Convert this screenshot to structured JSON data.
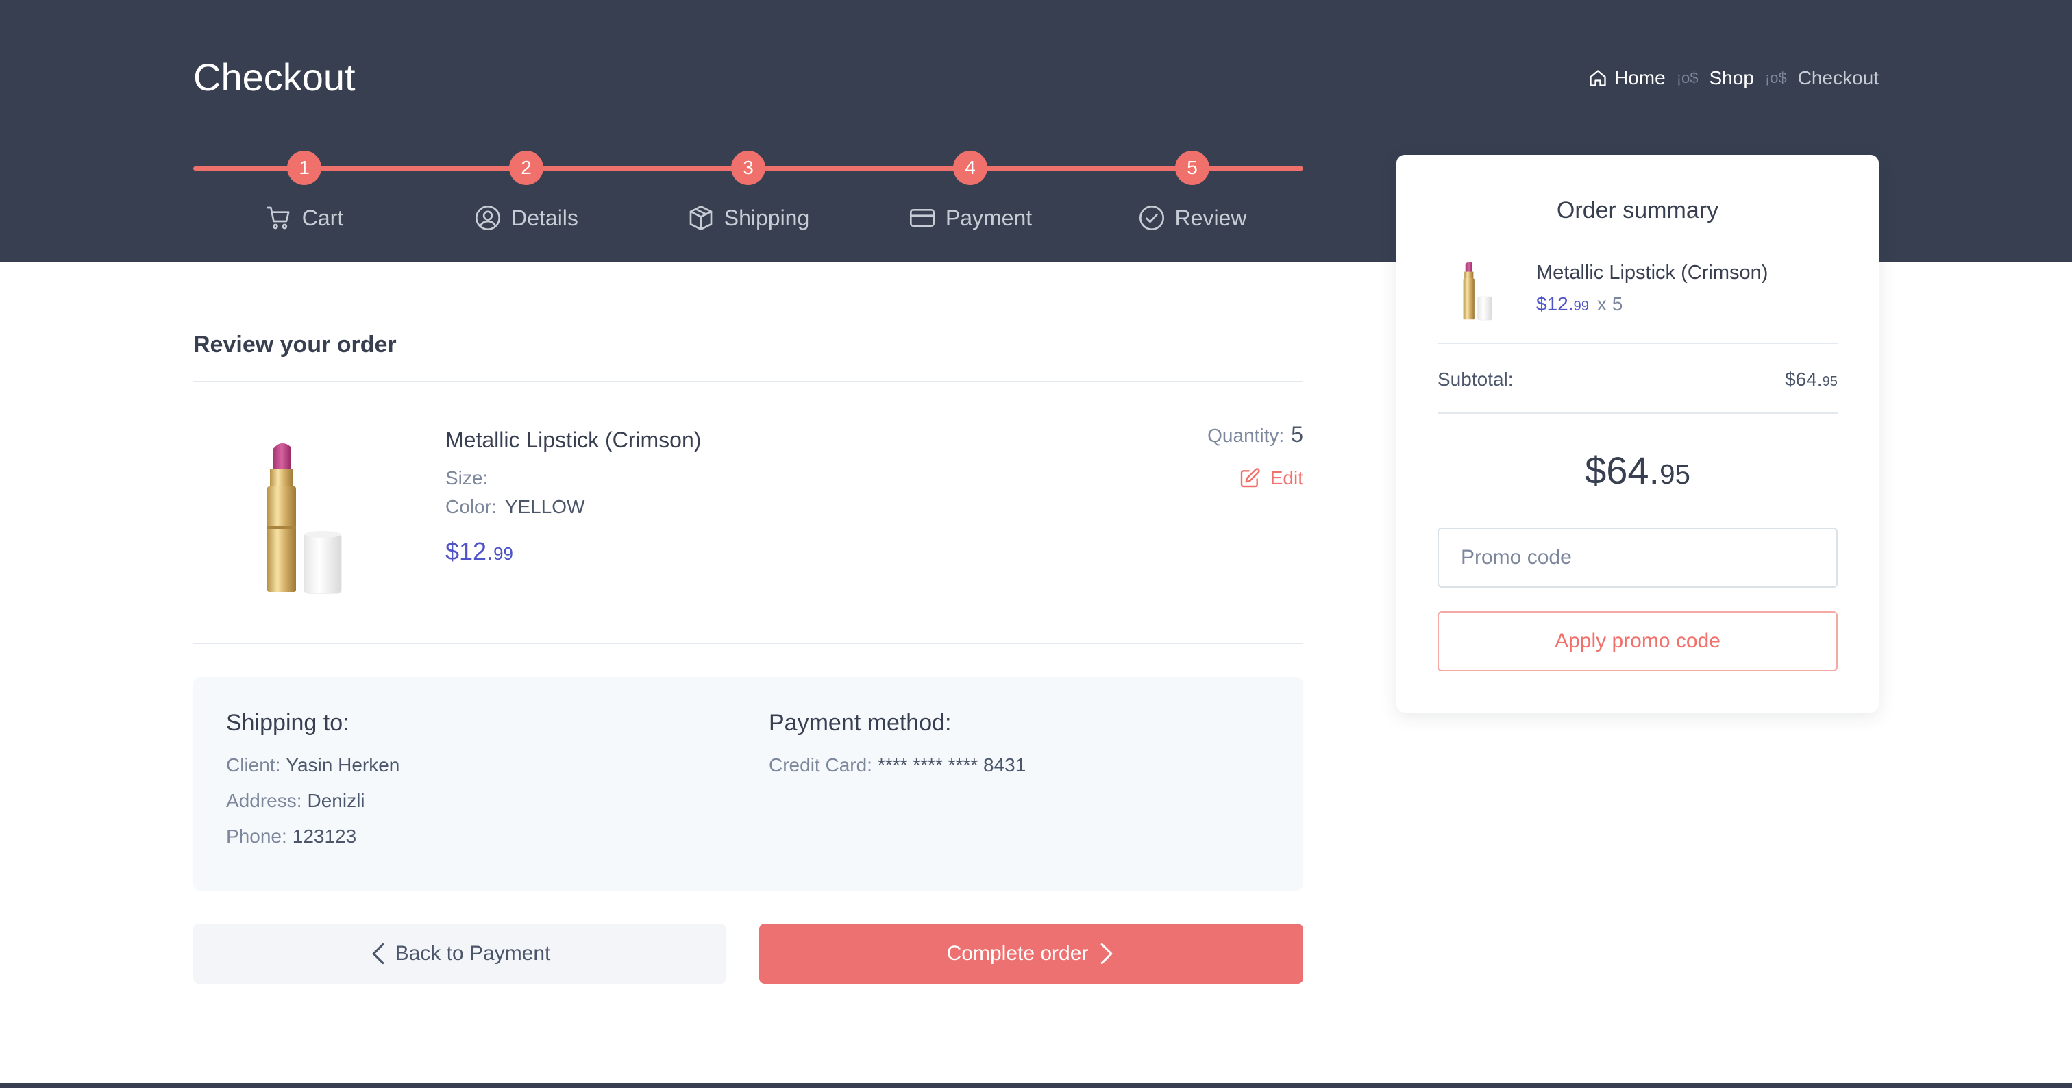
{
  "page": {
    "title": "Checkout"
  },
  "breadcrumb": {
    "home": "Home",
    "shop": "Shop",
    "current": "Checkout",
    "separator": "¡o$"
  },
  "steps": [
    {
      "number": "1",
      "label": "Cart",
      "icon": "cart-icon"
    },
    {
      "number": "2",
      "label": "Details",
      "icon": "user-circle-icon"
    },
    {
      "number": "3",
      "label": "Shipping",
      "icon": "package-icon"
    },
    {
      "number": "4",
      "label": "Payment",
      "icon": "credit-card-icon"
    },
    {
      "number": "5",
      "label": "Review",
      "icon": "check-circle-icon"
    }
  ],
  "review": {
    "heading": "Review your order",
    "item": {
      "name": "Metallic Lipstick (Crimson)",
      "size_label": "Size:",
      "color_label": "Color:",
      "color_value": "YELLOW",
      "price_main": "$12.",
      "price_cents": "99",
      "quantity_label": "Quantity:",
      "quantity_value": "5",
      "edit_label": "Edit"
    }
  },
  "shipping": {
    "heading": "Shipping to:",
    "client_label": "Client:",
    "client_value": "Yasin Herken",
    "address_label": "Address:",
    "address_value": "Denizli",
    "phone_label": "Phone:",
    "phone_value": "123123"
  },
  "payment": {
    "heading": "Payment method:",
    "card_label": "Credit Card:",
    "card_value": "**** **** **** 8431"
  },
  "actions": {
    "back_label": "Back to Payment",
    "complete_label": "Complete order"
  },
  "summary": {
    "title": "Order summary",
    "item_name": "Metallic Lipstick (Crimson)",
    "item_price_main": "$12.",
    "item_price_cents": "99",
    "item_qty": "x 5",
    "subtotal_label": "Subtotal:",
    "subtotal_main": "$64.",
    "subtotal_cents": "95",
    "total_main": "$64.",
    "total_cents": "95",
    "promo_placeholder": "Promo code",
    "apply_label": "Apply promo code"
  },
  "colors": {
    "header_bg": "#373f50",
    "accent": "#f0716b",
    "price": "#4e54c8"
  }
}
